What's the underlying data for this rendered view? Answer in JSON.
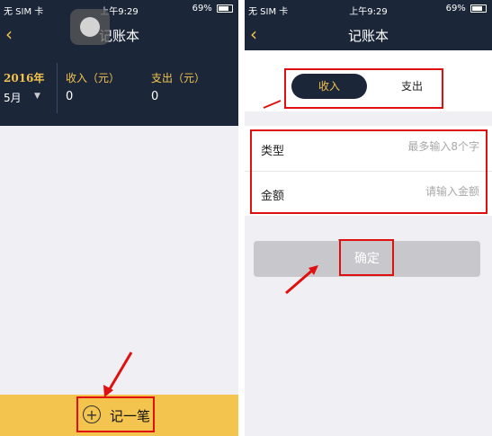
{
  "status_bar": {
    "carrier": "无 SIM 卡",
    "time": "上午9:29",
    "battery": "69%"
  },
  "app_title": "记账本",
  "summary": {
    "year": "2016年",
    "month": "5月",
    "income_label": "收入（元）",
    "income_value": "0",
    "expense_label": "支出（元）",
    "expense_value": "0"
  },
  "record_button": {
    "plus_icon": "+",
    "label": "记一笔"
  },
  "entry_form": {
    "tabs": [
      {
        "label": "收入",
        "selected": true
      },
      {
        "label": "支出",
        "selected": false
      }
    ],
    "type_label": "类型",
    "type_placeholder": "最多输入8个字",
    "amount_label": "金额",
    "amount_placeholder": "请输入金额",
    "confirm_label": "确定"
  },
  "colors": {
    "navy": "#1b2638",
    "accent_yellow": "#f3c44e",
    "annotation_red": "#e01010",
    "button_disabled": "#c8c8cc"
  },
  "icons": [
    "back-chevron-icon",
    "wifi-icon",
    "location-arrow-icon",
    "battery-icon",
    "plus-circle-icon"
  ]
}
